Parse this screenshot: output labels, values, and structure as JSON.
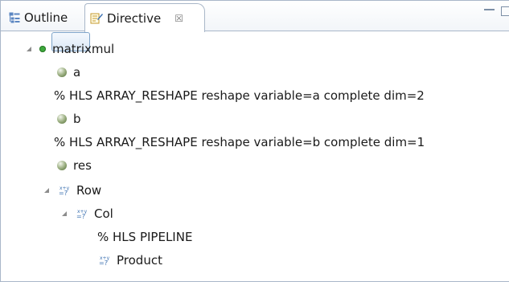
{
  "tabs": [
    {
      "label": "Outline",
      "icon": "outline-icon",
      "active": false
    },
    {
      "label": "Directive",
      "icon": "directive-icon",
      "active": true,
      "close": "☒"
    }
  ],
  "tree": {
    "root": {
      "label": "matrixmul",
      "icon": "function-dot-icon",
      "expanded": true
    },
    "items": [
      {
        "label": "a",
        "icon": "variable-ball-icon",
        "selected": true
      },
      {
        "label": "% HLS ARRAY_RESHAPE reshape variable=a complete dim=2",
        "icon": ""
      },
      {
        "label": "b",
        "icon": "variable-ball-icon"
      },
      {
        "label": "% HLS ARRAY_RESHAPE reshape variable=b complete dim=1",
        "icon": ""
      },
      {
        "label": "res",
        "icon": "variable-ball-icon"
      },
      {
        "label": "Row",
        "icon": "loop-icon",
        "expanded": true
      },
      {
        "label": "Col",
        "icon": "loop-icon",
        "expanded": true
      },
      {
        "label": "% HLS PIPELINE",
        "icon": ""
      },
      {
        "label": "Product",
        "icon": "loop-icon"
      }
    ]
  },
  "colors": {
    "accent_border": "#a9b7c9",
    "selection": "#dbe8f6",
    "dot": "#3ea83c"
  }
}
